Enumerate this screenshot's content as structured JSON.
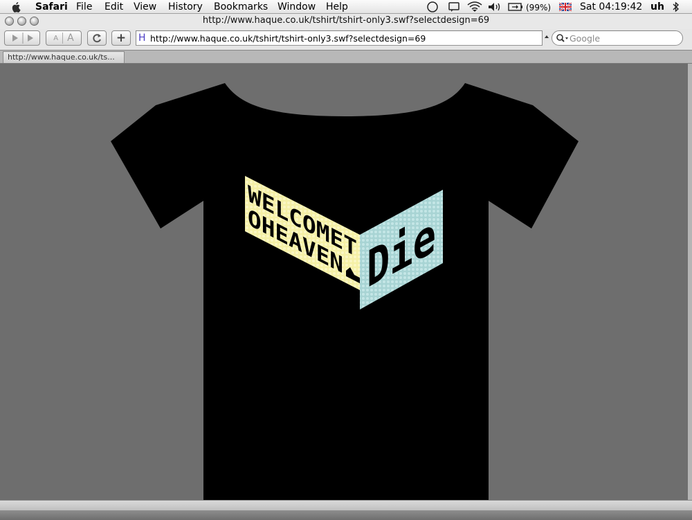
{
  "menubar": {
    "app": "Safari",
    "items": [
      "File",
      "Edit",
      "View",
      "History",
      "Bookmarks",
      "Window",
      "Help"
    ],
    "battery": "(99%)",
    "clock": "Sat 04:19:42",
    "user": "uh"
  },
  "window": {
    "title": "http://www.haque.co.uk/tshirt/tshirt-only3.swf?selectdesign=69"
  },
  "toolbar": {
    "text_smaller": "A",
    "text_bigger": "A",
    "reload_icon": "reload-icon",
    "add_bookmark": "+",
    "favicon": "H",
    "url": "http://www.haque.co.uk/tshirt/tshirt-only3.swf?selectdesign=69",
    "search_placeholder": "Google"
  },
  "tab": {
    "label": "http://www.haque.co.uk/ts..."
  },
  "design": {
    "panel_left_line1": "WELCOMET",
    "panel_left_line2": "OHEAVEN",
    "panel_right": "Die",
    "colors": {
      "shirt": "#000000",
      "left_panel": "#f5f0a6",
      "right_panel": "#a8d4d4"
    }
  }
}
